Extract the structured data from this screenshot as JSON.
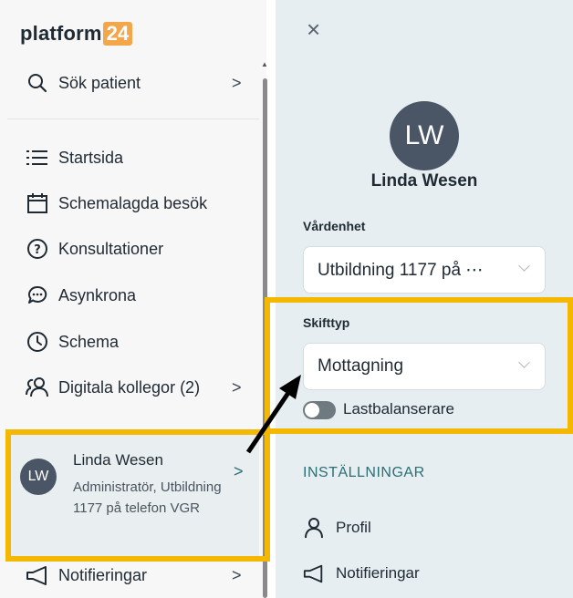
{
  "sidebar": {
    "logo": {
      "text": "platform",
      "badge": "24"
    },
    "search": {
      "label": "Sök patient",
      "chevron": ">"
    },
    "items": [
      {
        "label": "Startsida",
        "icon": "list-icon"
      },
      {
        "label": "Schemalagda besök",
        "icon": "calendar-icon"
      },
      {
        "label": "Konsultationer",
        "icon": "question-circle-icon"
      },
      {
        "label": "Asynkrona",
        "icon": "chat-bubbles-icon"
      },
      {
        "label": "Schema",
        "icon": "clock-icon"
      },
      {
        "label": "Digitala kollegor (2)",
        "icon": "people-icon",
        "chevron": ">"
      }
    ],
    "user": {
      "initials": "LW",
      "name": "Linda Wesen",
      "role": "Administratör, Utbildning 1177 på telefon VGR",
      "chevron": ">"
    },
    "notifications": {
      "label": "Notifieringar",
      "chevron": ">"
    }
  },
  "panel": {
    "close": "×",
    "initials": "LW",
    "name": "Linda Wesen",
    "vardenhet": {
      "label": "Vårdenhet",
      "value": "Utbildning 1177 på ⋯"
    },
    "skifttyp": {
      "label": "Skifttyp",
      "value": "Mottagning"
    },
    "toggle": {
      "label": "Lastbalanserare",
      "on": false
    },
    "settings_title": "INSTÄLLNINGAR",
    "items": [
      {
        "label": "Profil",
        "icon": "person-icon"
      },
      {
        "label": "Notifieringar",
        "icon": "megaphone-icon"
      }
    ]
  },
  "colors": {
    "highlight": "#f5b800",
    "accent": "#2a6f74",
    "avatar": "#4a5566",
    "panel_bg": "#e6eef1"
  }
}
